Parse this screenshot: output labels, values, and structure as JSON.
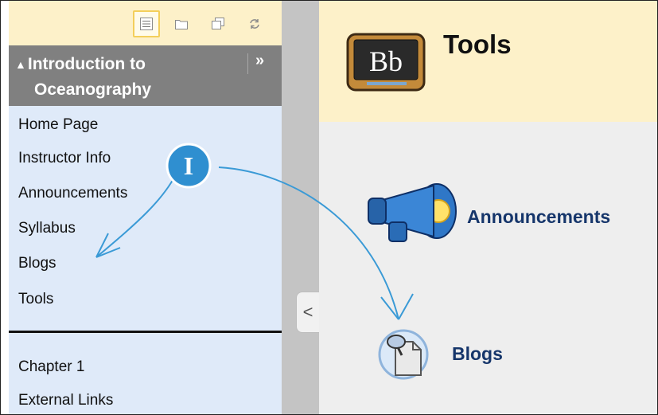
{
  "sidebar": {
    "toolbar": [
      {
        "name": "list-view-button-icon",
        "active": true
      },
      {
        "name": "folder-view-button-icon",
        "active": false
      },
      {
        "name": "windows-button-icon",
        "active": false
      },
      {
        "name": "refresh-button-icon",
        "active": false
      }
    ],
    "course_title_line1": "Introduction to",
    "course_title_line2": "Oceanography",
    "expand_glyph": "»",
    "menu_items": [
      "Home Page",
      "Instructor Info",
      "Announcements",
      "Syllabus",
      "Blogs",
      "Tools"
    ],
    "menu_items_2": [
      "Chapter 1",
      "External Links"
    ]
  },
  "toggle_glyph": "<",
  "header": {
    "logo_text": "Bb",
    "title": "Tools"
  },
  "tools": {
    "announcements_label": "Announcements",
    "blogs_label": "Blogs"
  },
  "callout": {
    "marker": "I",
    "color": "#2f8fd0"
  },
  "colors": {
    "header_bg": "#fdf1c9",
    "sidebar_bg": "#dfeaf9",
    "link": "#16366b",
    "menu_header_bg": "#808080"
  }
}
